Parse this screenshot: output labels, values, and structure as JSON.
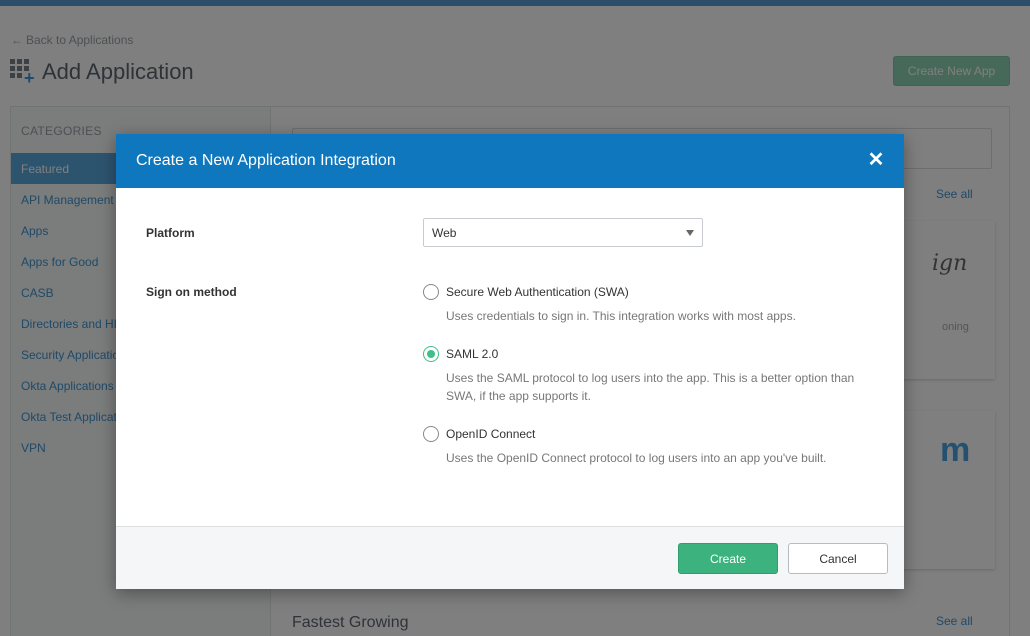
{
  "header": {
    "back_link": "Back to Applications",
    "back_arrow": "←",
    "title": "Add Application",
    "create_new_app": "Create New App"
  },
  "sidebar": {
    "heading": "CATEGORIES",
    "items": [
      {
        "label": "Featured",
        "active": true
      },
      {
        "label": "API Management"
      },
      {
        "label": "Apps"
      },
      {
        "label": "Apps for Good"
      },
      {
        "label": "CASB"
      },
      {
        "label": "Directories and HR Systems"
      },
      {
        "label": "Security Applications"
      },
      {
        "label": "Okta Applications"
      },
      {
        "label": "Okta Test Applications"
      },
      {
        "label": "VPN"
      }
    ]
  },
  "main": {
    "see_all": "See all",
    "card1_logo": "ign",
    "card1_sub": "oning",
    "card2_logo": "m",
    "fastest_growing": "Fastest Growing"
  },
  "dialog": {
    "title": "Create a New Application Integration",
    "close_glyph": "✕",
    "platform_label": "Platform",
    "platform_value": "Web",
    "sign_on_label": "Sign on method",
    "options": [
      {
        "label": "Secure Web Authentication (SWA)",
        "description": "Uses credentials to sign in. This integration works with most apps.",
        "selected": false
      },
      {
        "label": "SAML 2.0",
        "description": "Uses the SAML protocol to log users into the app. This is a better option than SWA, if the app supports it.",
        "selected": true
      },
      {
        "label": "OpenID Connect",
        "description": "Uses the OpenID Connect protocol to log users into an app you've built.",
        "selected": false
      }
    ],
    "create_label": "Create",
    "cancel_label": "Cancel"
  },
  "colors": {
    "dialog_header": "#0e77bd",
    "create_button": "#3cb37e",
    "sidebar_active": "#5aa9de",
    "link": "#3f94d1",
    "radio_selected": "#3fbf8a"
  }
}
